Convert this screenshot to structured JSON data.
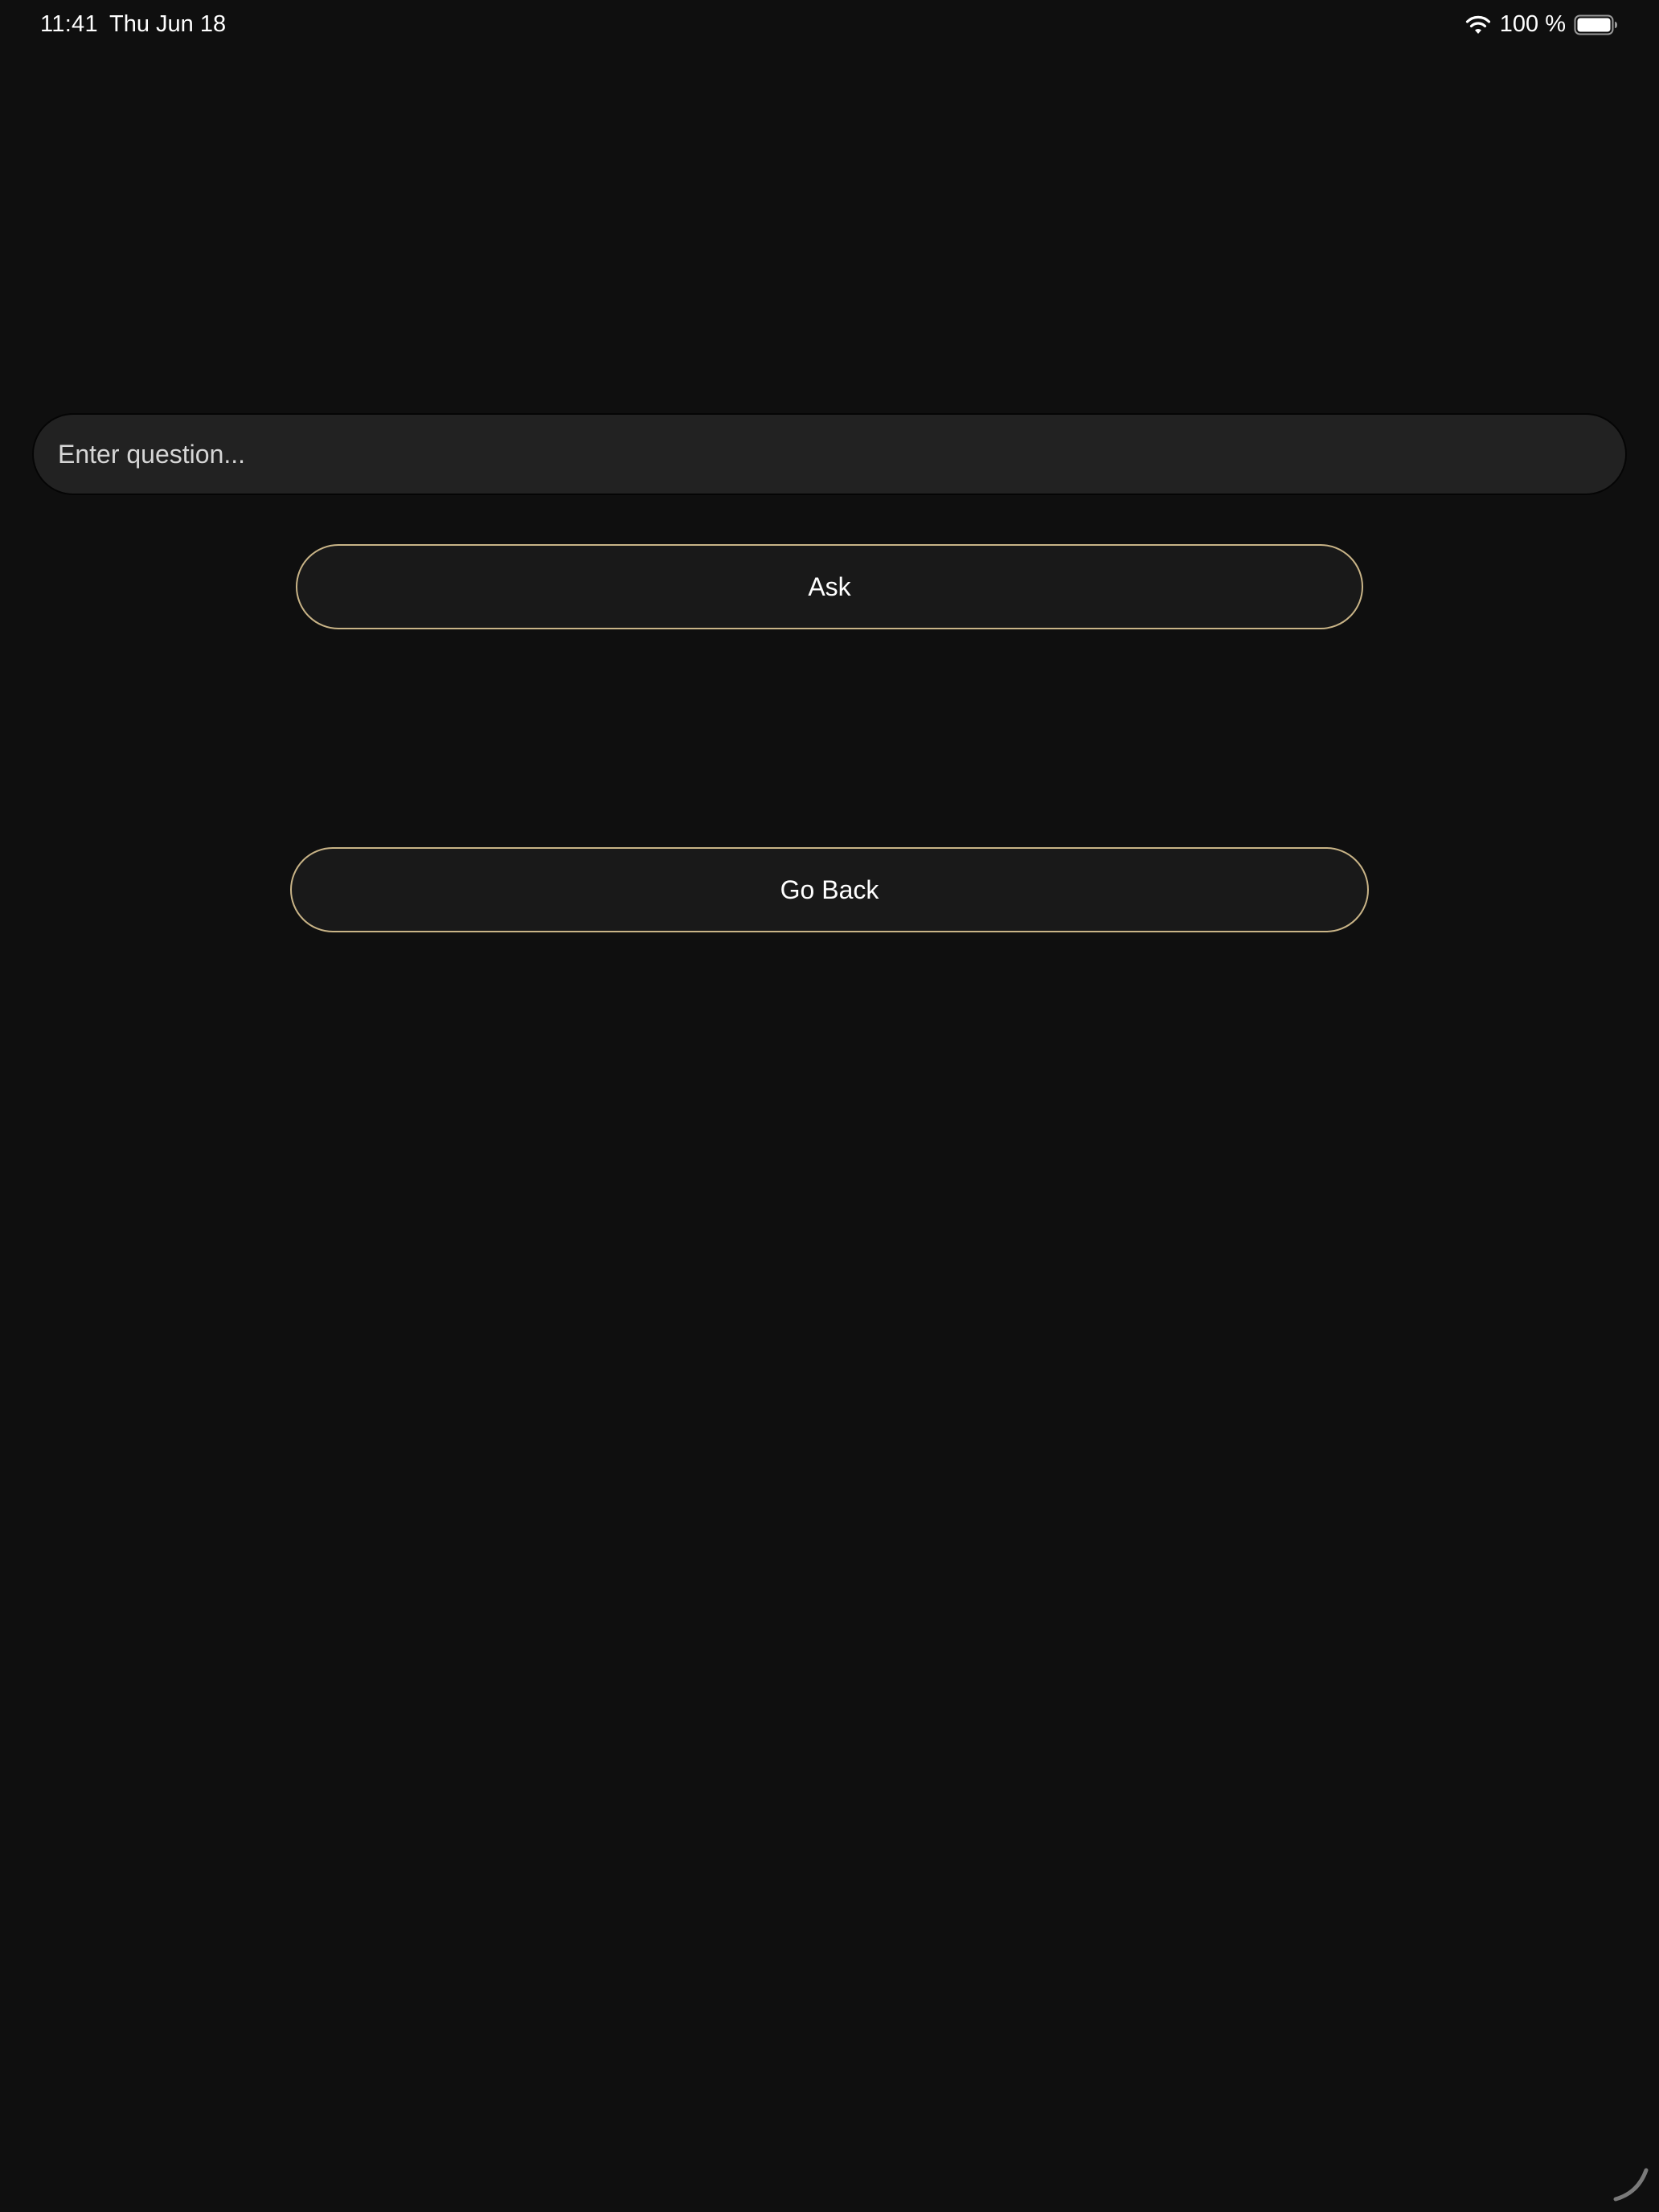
{
  "status_bar": {
    "time": "11:41",
    "date": "Thu Jun 18",
    "battery": "100 %",
    "wifi_icon": "wifi-icon",
    "battery_icon": "battery-full-icon"
  },
  "question": {
    "placeholder": "Enter question...",
    "value": ""
  },
  "buttons": {
    "ask_label": "Ask",
    "back_label": "Go Back"
  },
  "colors": {
    "background": "#0f0f0f",
    "field": "#222222",
    "button_fill": "#191919",
    "button_border": "#c9b487"
  }
}
